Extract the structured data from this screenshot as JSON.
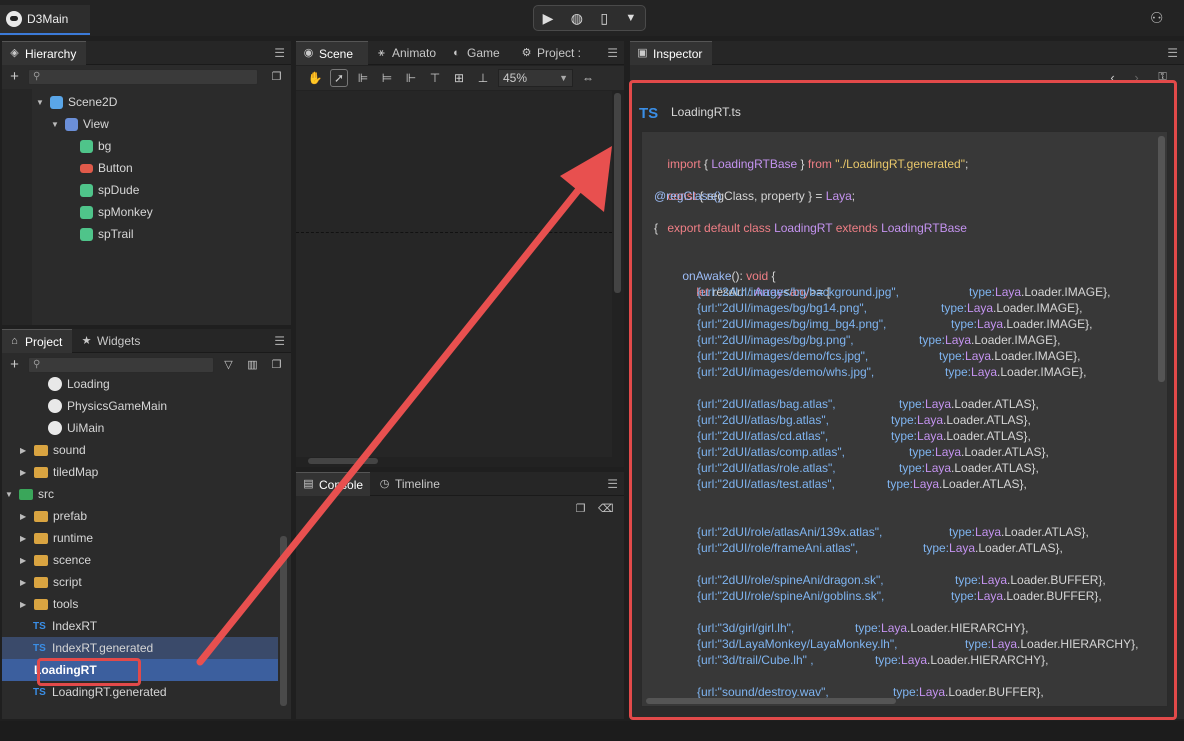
{
  "app": {
    "title": "D3Main"
  },
  "hierarchy": {
    "tab_label": "Hierarchy",
    "items": [
      {
        "label": "Scene2D"
      },
      {
        "label": "View"
      },
      {
        "label": "bg"
      },
      {
        "label": "Button"
      },
      {
        "label": "spDude"
      },
      {
        "label": "spMonkey"
      },
      {
        "label": "spTrail"
      }
    ]
  },
  "project": {
    "tab_label": "Project",
    "widgets_label": "Widgets",
    "items": [
      {
        "label": "Loading"
      },
      {
        "label": "PhysicsGameMain"
      },
      {
        "label": "UiMain"
      },
      {
        "label": "sound"
      },
      {
        "label": "tiledMap"
      },
      {
        "label": "src"
      },
      {
        "label": "prefab"
      },
      {
        "label": "runtime"
      },
      {
        "label": "scence"
      },
      {
        "label": "script"
      },
      {
        "label": "tools"
      },
      {
        "label": "IndexRT"
      },
      {
        "label": "IndexRT.generated"
      },
      {
        "label": "LoadingRT"
      },
      {
        "label": "LoadingRT.generated"
      }
    ]
  },
  "scene": {
    "tabs": [
      {
        "label": "Scene"
      },
      {
        "label": "Animato"
      },
      {
        "label": "Game"
      },
      {
        "label": "Project :"
      }
    ],
    "zoom": "45%"
  },
  "console": {
    "tabs": [
      {
        "label": "Console"
      },
      {
        "label": "Timeline"
      }
    ]
  },
  "inspector": {
    "tab_label": "Inspector",
    "file_badge": "TS",
    "file_name": "LoadingRT.ts",
    "code": {
      "l1": [
        "import",
        " { ",
        "LoadingRTBase",
        " } ",
        "from",
        " \"./LoadingRT.generated\"",
        ";"
      ],
      "l3": [
        "const",
        " { regClass, property } = ",
        "Laya",
        ";"
      ],
      "l4": "@regClass()",
      "l5": [
        "export default class",
        " ",
        "LoadingRT",
        " ",
        "extends",
        " ",
        "LoadingRTBase"
      ],
      "l6": "{",
      "l8": [
        "onAwake",
        "(): ",
        "void",
        " {"
      ],
      "l9": [
        "let",
        " resArr : ",
        "Array",
        "<",
        "any",
        ">= ["
      ],
      "res": [
        {
          "url": "{url:\"2dUI/images/bg/background.jpg\",",
          "type": "IMAGE"
        },
        {
          "url": "{url:\"2dUI/images/bg/bg14.png\",",
          "type": "IMAGE"
        },
        {
          "url": "{url:\"2dUI/images/bg/img_bg4.png\",",
          "type": "IMAGE"
        },
        {
          "url": "{url:\"2dUI/images/bg/bg.png\",",
          "type": "IMAGE"
        },
        {
          "url": "{url:\"2dUI/images/demo/fcs.jpg\",",
          "type": "IMAGE"
        },
        {
          "url": "{url:\"2dUI/images/demo/whs.jpg\",",
          "type": "IMAGE"
        },
        {
          "url": "{url:\"2dUI/atlas/bag.atlas\",",
          "type": "ATLAS"
        },
        {
          "url": "{url:\"2dUI/atlas/bg.atlas\",",
          "type": "ATLAS"
        },
        {
          "url": "{url:\"2dUI/atlas/cd.atlas\",",
          "type": "ATLAS"
        },
        {
          "url": "{url:\"2dUI/atlas/comp.atlas\",",
          "type": "ATLAS"
        },
        {
          "url": "{url:\"2dUI/atlas/role.atlas\",",
          "type": "ATLAS"
        },
        {
          "url": "{url:\"2dUI/atlas/test.atlas\",",
          "type": "ATLAS"
        },
        {
          "url": "{url:\"2dUI/role/atlasAni/139x.atlas\",",
          "type": "ATLAS"
        },
        {
          "url": "{url:\"2dUI/role/frameAni.atlas\",",
          "type": "ATLAS"
        },
        {
          "url": "{url:\"2dUI/role/spineAni/dragon.sk\",",
          "type": "BUFFER"
        },
        {
          "url": "{url:\"2dUI/role/spineAni/goblins.sk\",",
          "type": "BUFFER"
        },
        {
          "url": "{url:\"3d/girl/girl.lh\",",
          "type": "HIERARCHY"
        },
        {
          "url": "{url:\"3d/LayaMonkey/LayaMonkey.lh\",",
          "type": "HIERARCHY"
        },
        {
          "url": "{url:\"3d/trail/Cube.lh\" ,",
          "type": "HIERARCHY"
        },
        {
          "url": "{url:\"sound/destroy.wav\",",
          "type": "BUFFER"
        }
      ],
      "type_prefix": "type:",
      "laya": "Laya",
      "loader": ".Loader.",
      "suffix": "},"
    }
  }
}
